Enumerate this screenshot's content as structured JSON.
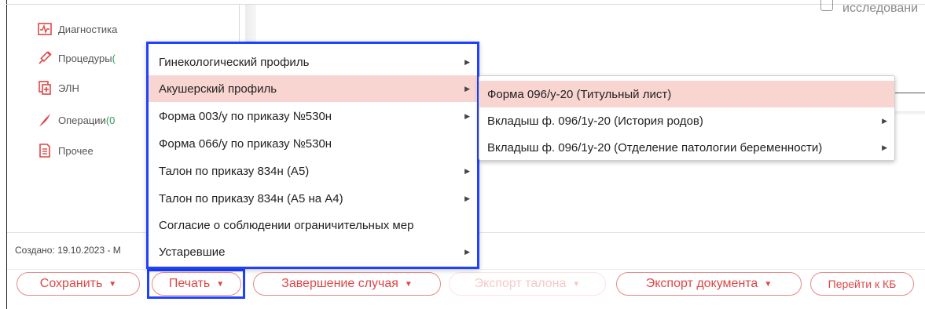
{
  "sidebar": {
    "items": [
      {
        "label": "Диагностика",
        "count": "",
        "icon": "heart-monitor-icon"
      },
      {
        "label": "Процедуры",
        "count": "(",
        "icon": "syringe-icon"
      },
      {
        "label": "ЭЛН",
        "count": "",
        "icon": "document-plus-icon"
      },
      {
        "label": "Операции",
        "count": "(0",
        "icon": "scalpel-icon"
      },
      {
        "label": "Прочее",
        "count": "",
        "icon": "document-icon"
      }
    ]
  },
  "header": {
    "study_text": "исследовани"
  },
  "footer": {
    "created_text": "Создано: 19.10.2023 - М"
  },
  "print_menu": {
    "items": [
      {
        "label": "Гинекологический профиль",
        "arrow": "▶"
      },
      {
        "label": "Акушерский профиль",
        "arrow": "▶"
      },
      {
        "label": "Форма 003/у по приказу №530н",
        "arrow": "▶"
      },
      {
        "label": "Форма 066/у по приказу №530н",
        "arrow": ""
      },
      {
        "label": "Талон по приказу 834н (А5)",
        "arrow": "▶"
      },
      {
        "label": "Талон по приказу 834н (А5 на А4)",
        "arrow": "▶"
      },
      {
        "label": "Согласие о соблюдении ограничительных мер",
        "arrow": ""
      },
      {
        "label": "Устаревшие",
        "arrow": "▶"
      }
    ],
    "active_index": 1
  },
  "submenu": {
    "items": [
      {
        "label": "Форма 096/у-20 (Титульный лист)",
        "arrow": ""
      },
      {
        "label": "Вкладыш ф. 096/1у-20 (История родов)",
        "arrow": "▶"
      },
      {
        "label": "Вкладыш ф. 096/1у-20 (Отделение патологии беременности)",
        "arrow": "▶"
      }
    ]
  },
  "buttons": {
    "save": "Сохранить",
    "print": "Печать",
    "finish_case": "Завершение случая",
    "export_ticket": "Экспорт талона",
    "export_document": "Экспорт документа",
    "go_to_kb": "Перейти к КБ",
    "caret": "▼"
  },
  "colors": {
    "accent": "#e04646",
    "highlight": "#f8d5d0",
    "focus_outline": "#2041ff"
  }
}
